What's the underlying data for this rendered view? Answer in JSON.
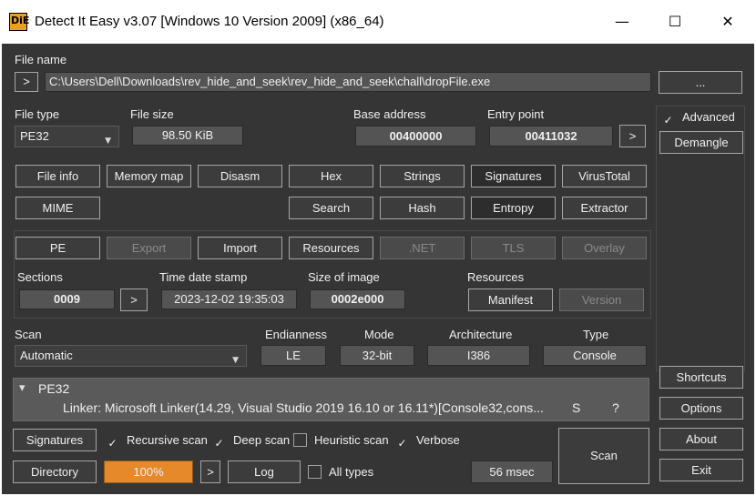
{
  "window": {
    "title": "Detect It Easy v3.07 [Windows 10 Version 2009] (x86_64)",
    "icon_text": "DiE",
    "minimize_glyph": "—",
    "maximize_glyph": "☐",
    "close_glyph": "✕"
  },
  "file": {
    "label": "File name",
    "expand_button": ">",
    "path": "C:\\Users\\Dell\\Downloads\\rev_hide_and_seek\\rev_hide_and_seek\\chall\\dropFile.exe",
    "browse_button": "..."
  },
  "info": {
    "file_type_label": "File type",
    "file_type_value": "PE32",
    "file_size_label": "File size",
    "file_size_value": "98.50 KiB",
    "base_address_label": "Base address",
    "base_address_value": "00400000",
    "entry_point_label": "Entry point",
    "entry_point_value": "00411032",
    "entry_point_button": ">"
  },
  "side": {
    "advanced_label": "Advanced",
    "advanced_checked": true,
    "demangle": "Demangle",
    "shortcuts": "Shortcuts",
    "options": "Options",
    "about": "About",
    "exit": "Exit"
  },
  "tools": {
    "row1": [
      "File info",
      "Memory map",
      "Disasm",
      "Hex",
      "Strings",
      "Signatures",
      "VirusTotal"
    ],
    "row2_left": "MIME",
    "row2": [
      "Search",
      "Hash",
      "Entropy",
      "Extractor"
    ]
  },
  "pe": {
    "tabs": [
      "PE",
      "Export",
      "Import",
      "Resources",
      ".NET",
      "TLS",
      "Overlay"
    ],
    "sections_label": "Sections",
    "sections_value": "0009",
    "sections_button": ">",
    "timestamp_label": "Time date stamp",
    "timestamp_value": "2023-12-02 19:35:03",
    "image_size_label": "Size of image",
    "image_size_value": "0002e000",
    "resources_label": "Resources",
    "manifest_button": "Manifest",
    "version_button": "Version"
  },
  "scan": {
    "label": "Scan",
    "mode_value": "Automatic",
    "endianness_label": "Endianness",
    "endianness_value": "LE",
    "mode_label": "Mode",
    "bitness_value": "32-bit",
    "architecture_label": "Architecture",
    "architecture_value": "I386",
    "type_label": "Type",
    "type_value": "Console"
  },
  "result": {
    "toggle_glyph": "▾",
    "header": "PE32",
    "line": "Linker: Microsoft Linker(14.29, Visual Studio 2019 16.10 or 16.11*)[Console32,cons...",
    "col_s": "S",
    "col_q": "?"
  },
  "bottom": {
    "signatures_button": "Signatures",
    "recursive_label": "Recursive scan",
    "recursive_checked": true,
    "deep_label": "Deep scan",
    "deep_checked": true,
    "heuristic_label": "Heuristic scan",
    "heuristic_checked": false,
    "verbose_label": "Verbose",
    "verbose_checked": true,
    "directory_button": "Directory",
    "progress_text": "100%",
    "progress_value": 1.0,
    "progress_arrow": ">",
    "log_button": "Log",
    "all_types_label": "All types",
    "all_types_checked": false,
    "time_value": "56 msec",
    "scan_button": "Scan"
  },
  "colors": {
    "background": "#353535",
    "progress": "#e6892a",
    "accent_icon": "#e8a020"
  }
}
